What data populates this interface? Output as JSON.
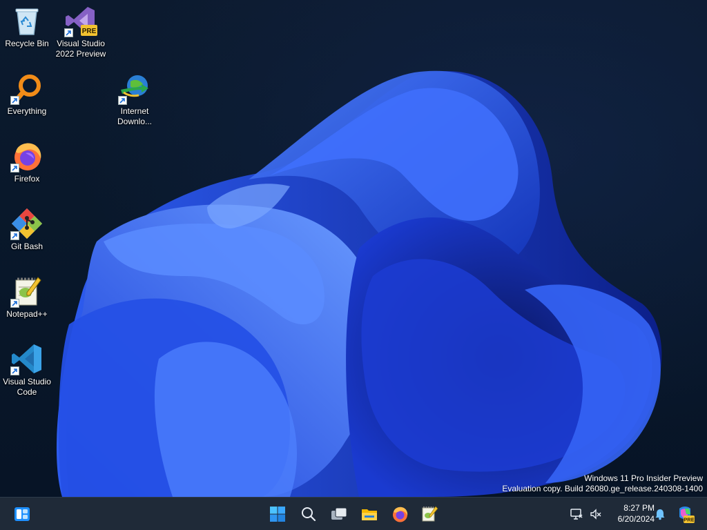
{
  "desktop": {
    "icons": [
      {
        "label": "Recycle Bin"
      },
      {
        "label": "Visual Studio 2022 Preview",
        "badge": "PRE"
      },
      {
        "label": "Everything"
      },
      {
        "label": "Internet Downlo..."
      },
      {
        "label": "Firefox"
      },
      {
        "label": "Git Bash"
      },
      {
        "label": "Notepad++"
      },
      {
        "label": "Visual Studio Code"
      }
    ]
  },
  "watermark": {
    "line1": "Windows 11 Pro Insider Preview",
    "line2": "Evaluation copy. Build 26080.ge_release.240308-1400"
  },
  "taskbar": {
    "clock": {
      "time": "8:27 PM",
      "date": "6/20/2024"
    },
    "copilot_badge": "PRE"
  },
  "colors": {
    "wallpaper_blue": "#2a55e8",
    "taskbar": "#1f2a38",
    "accent": "#3a8ee6"
  }
}
